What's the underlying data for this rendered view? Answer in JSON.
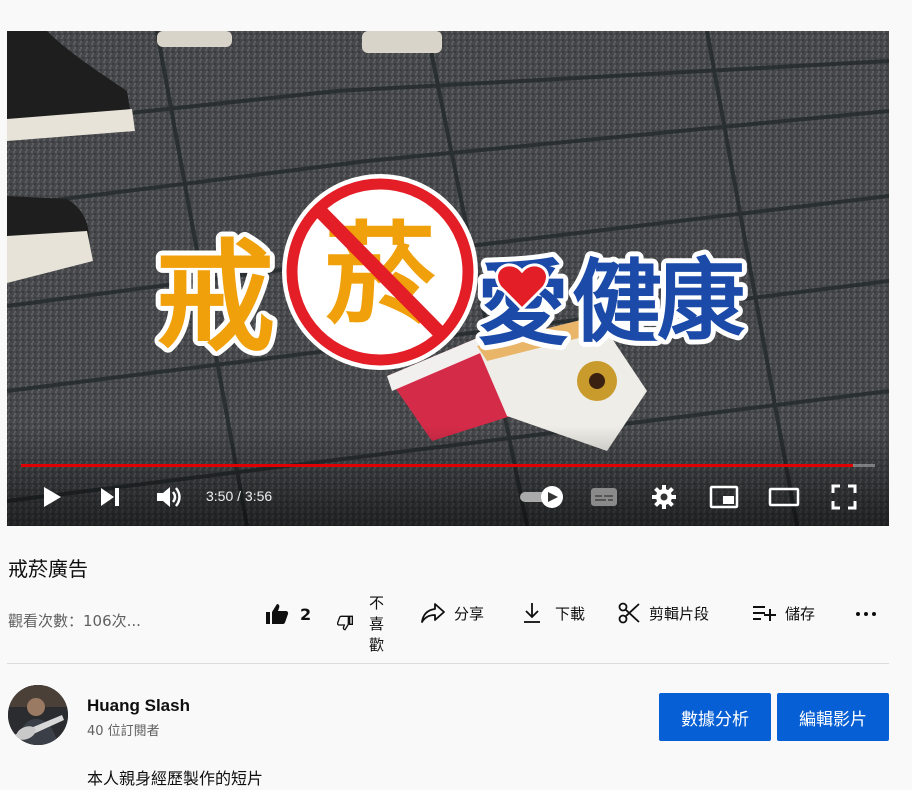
{
  "player": {
    "time_display": "3:50 / 3:56",
    "progress_fraction": 0.974,
    "overlay_text": [
      "戒",
      "菸",
      "愛",
      "健",
      "康"
    ],
    "progress_color": "#e00000"
  },
  "video": {
    "title": "戒菸廣告",
    "views": "觀看次數：106次..."
  },
  "actions": {
    "like_count": "2",
    "dislike_label": [
      "不",
      "喜",
      "歡"
    ],
    "share": "分享",
    "download": "下載",
    "clip": "剪輯片段",
    "save": "儲存"
  },
  "channel": {
    "name": "Huang Slash",
    "subscribers": "40 位訂閱者",
    "analytics_button": "數據分析",
    "edit_button": "編輯影片",
    "accent": "#065fd4"
  },
  "description": "本人親身經歷製作的短片"
}
